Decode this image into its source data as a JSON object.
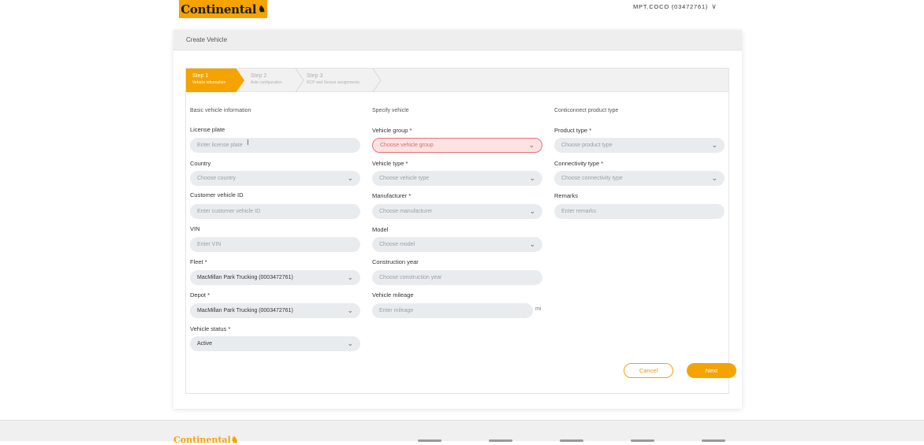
{
  "header": {
    "logo_text": "Continental",
    "logo_horse": "♞",
    "user_label": "MPT.COCO (03472761)",
    "user_chevron": "∨"
  },
  "card": {
    "title": "Create Vehicle"
  },
  "stepper": [
    {
      "title": "Step 1",
      "subtitle": "Vehicle information"
    },
    {
      "title": "Step 2",
      "subtitle": "Axle configuration"
    },
    {
      "title": "Step 3",
      "subtitle": "RCP and Sensor assignments"
    }
  ],
  "columns": {
    "basic": "Basic vehicle information",
    "specify": "Specify vehicle",
    "product": "Conticonnect product type"
  },
  "fields": {
    "license_plate": {
      "label": "License plate",
      "placeholder": "Enter license plate"
    },
    "country": {
      "label": "Country",
      "placeholder": "Choose country"
    },
    "customer_vehicle_id": {
      "label": "Customer vehicle ID",
      "placeholder": "Enter customer vehicle ID"
    },
    "vin": {
      "label": "VIN",
      "placeholder": "Enter VIN"
    },
    "fleet": {
      "label": "Fleet *",
      "value": "MacMillan Park Trucking (0003472761)"
    },
    "depot": {
      "label": "Depot *",
      "value": "MacMillan Park Trucking (0003472761)"
    },
    "vehicle_status": {
      "label": "Vehicle status *",
      "value": "Active"
    },
    "vehicle_group": {
      "label": "Vehicle group *",
      "placeholder": "Choose vehicle group"
    },
    "vehicle_type": {
      "label": "Vehicle type *",
      "placeholder": "Choose vehicle type"
    },
    "manufacturer": {
      "label": "Manufacturer *",
      "placeholder": "Choose manufacturer"
    },
    "model": {
      "label": "Model",
      "placeholder": "Choose model"
    },
    "construction_year": {
      "label": "Construction year",
      "placeholder": "Choose construction year"
    },
    "vehicle_mileage": {
      "label": "Vehicle mileage",
      "placeholder": "Enter mileage",
      "unit": "mi"
    },
    "product_type": {
      "label": "Product type *",
      "placeholder": "Choose product type"
    },
    "connectivity_type": {
      "label": "Connectivity type *",
      "placeholder": "Choose connectivity type"
    },
    "remarks": {
      "label": "Remarks",
      "placeholder": "Enter remarks"
    }
  },
  "caret": "⌄",
  "buttons": {
    "cancel": "Cancel",
    "next": "Next"
  },
  "footer": {
    "logo_text": "Continental♞"
  },
  "colors": {
    "accent": "#f5a300",
    "error_bg": "#fde2e2",
    "error_border": "#e57373"
  }
}
